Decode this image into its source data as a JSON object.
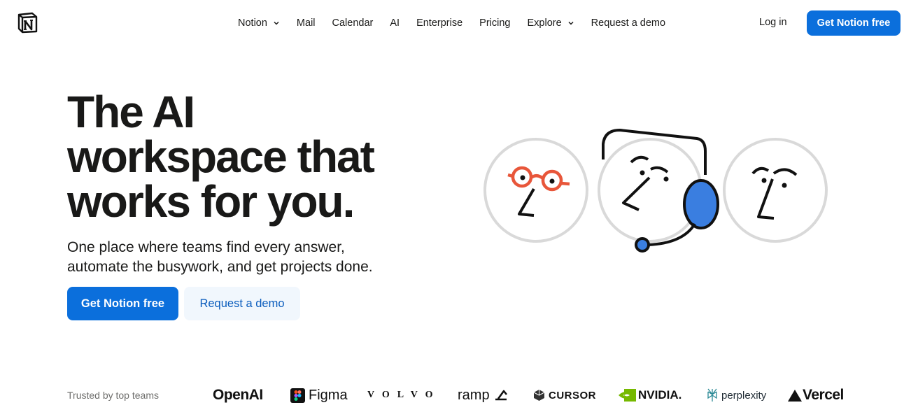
{
  "header": {
    "logo_alt": "Notion",
    "nav": [
      {
        "label": "Notion",
        "has_dropdown": true
      },
      {
        "label": "Mail",
        "has_dropdown": false
      },
      {
        "label": "Calendar",
        "has_dropdown": false
      },
      {
        "label": "AI",
        "has_dropdown": false
      },
      {
        "label": "Enterprise",
        "has_dropdown": false
      },
      {
        "label": "Pricing",
        "has_dropdown": false
      },
      {
        "label": "Explore",
        "has_dropdown": true
      },
      {
        "label": "Request a demo",
        "has_dropdown": false
      }
    ],
    "login_label": "Log in",
    "cta_label": "Get Notion free"
  },
  "hero": {
    "headline_line1": "The AI",
    "headline_line2": "workspace that",
    "headline_line3": "works for you.",
    "subhead_line1": "One place where teams find every answer,",
    "subhead_line2": "automate the busywork, and get projects done.",
    "primary_cta": "Get Notion free",
    "secondary_cta": "Request a demo"
  },
  "trusted": {
    "label": "Trusted by top teams",
    "brands": [
      "OpenAI",
      "Figma",
      "VOLVO",
      "ramp",
      "CURSOR",
      "NVIDIA.",
      "perplexity",
      "Vercel"
    ]
  },
  "colors": {
    "accent": "#0b6fdc",
    "secondary_bg": "#f1f7fd",
    "glasses": "#e8563a",
    "headset": "#3a7ee0",
    "nvidia_green": "#76b900"
  }
}
